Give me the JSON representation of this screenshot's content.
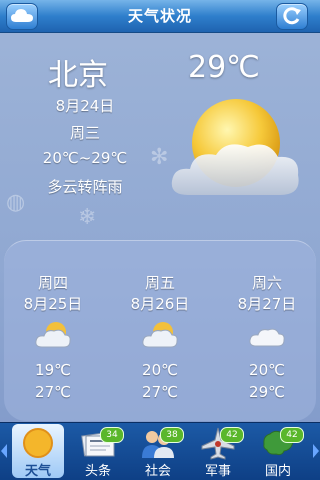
{
  "header": {
    "title": "天气状况",
    "left_icon": "cloud-icon",
    "right_icon": "refresh-icon"
  },
  "current": {
    "city": "北京",
    "temperature": "29℃",
    "date": "8月24日",
    "weekday": "周三",
    "range": "20℃~29℃",
    "condition": "多云转阵雨",
    "icon": "sun-behind-cloud-icon"
  },
  "forecast": [
    {
      "day": "周四",
      "date": "8月25日",
      "low": "19℃",
      "high": "27℃",
      "icon": "partly-cloudy-icon"
    },
    {
      "day": "周五",
      "date": "8月26日",
      "low": "20℃",
      "high": "27℃",
      "icon": "partly-cloudy-icon"
    },
    {
      "day": "周六",
      "date": "8月27日",
      "low": "20℃",
      "high": "29℃",
      "icon": "cloudy-icon"
    }
  ],
  "nav": {
    "tabs": [
      {
        "label": "天气",
        "icon": "sun-icon",
        "active": true
      },
      {
        "label": "头条",
        "icon": "newspaper-icon",
        "badge": "34"
      },
      {
        "label": "社会",
        "icon": "people-icon",
        "badge": "38"
      },
      {
        "label": "军事",
        "icon": "fighter-jet-icon",
        "badge": "42"
      },
      {
        "label": "国内",
        "icon": "china-map-icon",
        "badge": "42"
      }
    ]
  },
  "colors": {
    "titlebar": "#2f7fcc",
    "background": "#90a8d2",
    "navbar": "#0e3f85",
    "badge": "#5ab72b"
  }
}
